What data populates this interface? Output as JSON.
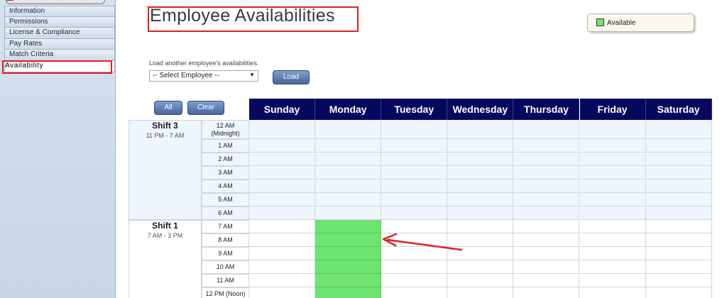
{
  "sidebar": {
    "items": [
      {
        "label": "Information"
      },
      {
        "label": "Permissions"
      },
      {
        "label": "License & Compliance"
      },
      {
        "label": "Pay Rates"
      },
      {
        "label": "Match Criteria"
      },
      {
        "label": "Availability",
        "active": true
      }
    ]
  },
  "page_title": "Employee Availabilities",
  "legend": {
    "label": "Available",
    "color": "#6fe36f"
  },
  "load": {
    "label": "Load another employee's availabilities.",
    "select_value": "-- Select Employee --",
    "button": "Load"
  },
  "controls": {
    "all": "All",
    "clear": "Clear"
  },
  "days": [
    "Sunday",
    "Monday",
    "Tuesday",
    "Wednesday",
    "Thursday",
    "Friday",
    "Saturday"
  ],
  "shifts": [
    {
      "name": "Shift 3",
      "time": "11 PM - 7 AM",
      "hours": [
        "12 AM (Midnight)",
        "1 AM",
        "2 AM",
        "3 AM",
        "4 AM",
        "5 AM",
        "6 AM"
      ]
    },
    {
      "name": "Shift 1",
      "time": "7 AM - 3 PM",
      "hours": [
        "7 AM",
        "8 AM",
        "9 AM",
        "10 AM",
        "11 AM",
        "12 PM (Noon)"
      ]
    }
  ],
  "available": [
    {
      "day": "Monday",
      "hour": "7 AM"
    },
    {
      "day": "Monday",
      "hour": "8 AM"
    },
    {
      "day": "Monday",
      "hour": "9 AM"
    },
    {
      "day": "Monday",
      "hour": "10 AM"
    },
    {
      "day": "Monday",
      "hour": "11 AM"
    },
    {
      "day": "Monday",
      "hour": "12 PM (Noon)"
    }
  ]
}
